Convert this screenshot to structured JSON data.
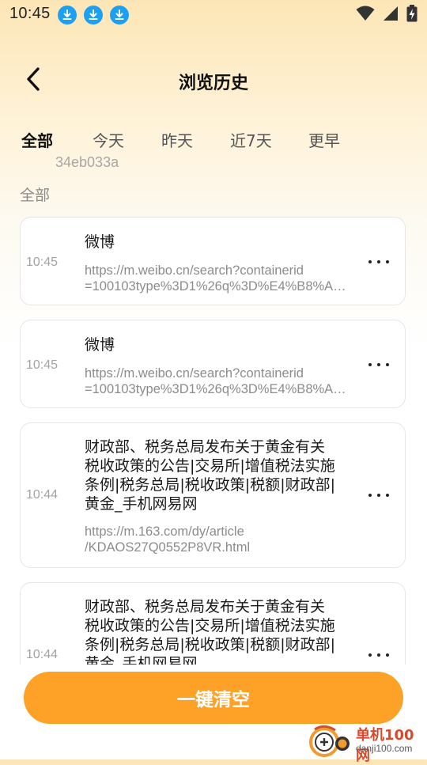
{
  "status_bar": {
    "time": "10:45",
    "download_icons": [
      "download-icon",
      "download-icon",
      "download-icon"
    ],
    "right_icons": [
      "wifi-icon",
      "signal-icon",
      "battery-charging-icon"
    ]
  },
  "header": {
    "back_icon": "chevron-left-icon",
    "title": "浏览历史"
  },
  "tabs": [
    {
      "label": "全部",
      "active": true
    },
    {
      "label": "今天",
      "active": false
    },
    {
      "label": "昨天",
      "active": false
    },
    {
      "label": "近7天",
      "active": false
    },
    {
      "label": "更早",
      "active": false
    }
  ],
  "debug_id": "34eb033a",
  "section_label": "全部",
  "history": [
    {
      "time": "10:45",
      "title": "微博",
      "url": "https://m.weibo.cn/search?containerid\n=100103type%3D1%26q%3D%E4%B8%A…"
    },
    {
      "time": "10:45",
      "title": "微博",
      "url": "https://m.weibo.cn/search?containerid\n=100103type%3D1%26q%3D%E4%B8%A…"
    },
    {
      "time": "10:44",
      "title": "财政部、税务总局发布关于黄金有关\n税收政策的公告|交易所|增值税法实施\n条例|税务总局|税收政策|税额|财政部|\n黄金_手机网易网",
      "url": "https://m.163.com/dy/article\n/KDAOS27Q0552P8VR.html"
    },
    {
      "time": "10:44",
      "title": "财政部、税务总局发布关于黄金有关\n税收政策的公告|交易所|增值税法实施\n条例|税务总局|税收政策|税额|财政部|\n黄金_手机网易网",
      "url": ""
    }
  ],
  "clear_button": {
    "label": "一键清空"
  },
  "watermark": {
    "name": "单机100网",
    "site": "danji100.com"
  },
  "colors": {
    "accent": "#fda227",
    "download_icon": "#1ea0f2",
    "watermark_red": "#d84a2b"
  }
}
